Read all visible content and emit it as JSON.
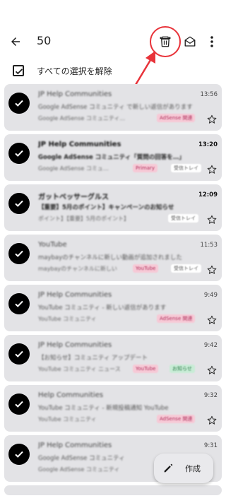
{
  "header": {
    "selected_count": "50",
    "back_icon": "arrow-back-icon",
    "delete_icon": "trash-icon",
    "mark_read_icon": "envelope-open-icon",
    "more_icon": "more-vert-icon"
  },
  "selection": {
    "deselect_all_label": "すべての選択を解除"
  },
  "emails": [
    {
      "sender": "JP Help Communities",
      "time": "13:56",
      "subject": "Google AdSense コミュニティ で新しい返信があります",
      "snippet": "Google AdSense コミュニティ...",
      "chips": [
        {
          "label": "AdSense 関連",
          "bg": "#f6c9d6",
          "fg": "#b0305c"
        }
      ],
      "unread": false
    },
    {
      "sender": "JP Help Communities",
      "time": "13:20",
      "subject": "Google AdSense コミュニティ「質問の回答を…」",
      "snippet": "Google AdSense コミュ…",
      "chips": [
        {
          "label": "Primary",
          "bg": "#f6c9d6",
          "fg": "#b0305c"
        },
        {
          "label": "受信トレイ",
          "bg": "#ffffff",
          "fg": "#555555"
        }
      ],
      "unread": true
    },
    {
      "sender": "ガットベッサーグルス",
      "time": "12:09",
      "subject": "【重要】5月のポイント】キャンペーンのお知らせ",
      "snippet": "ポイント】【重要】5月のポイント】",
      "chips": [
        {
          "label": "受信トレイ",
          "bg": "#ffffff",
          "fg": "#555555"
        }
      ],
      "unread": true
    },
    {
      "sender": "YouTube",
      "time": "11:53",
      "subject": "maybayのチャンネルに新しい動画が追加されました",
      "snippet": "maybayのチャンネルに新しい",
      "chips": [
        {
          "label": "YouTube",
          "bg": "#f6c9d6",
          "fg": "#b0305c"
        },
        {
          "label": "受信トレイ",
          "bg": "#ffffff",
          "fg": "#555555"
        }
      ],
      "unread": false
    },
    {
      "sender": "JP Help Communities",
      "time": "9:49",
      "subject": "YouTube コミュニティ - 新しい返信があります",
      "snippet": "YouTube コミュニティ",
      "chips": [
        {
          "label": "AdSense 関連",
          "bg": "#f6c9d6",
          "fg": "#b0305c"
        }
      ],
      "unread": false
    },
    {
      "sender": "JP Help Communities",
      "time": "9:42",
      "subject": "【お知らせ】コミュニティ アップデート",
      "snippet": "YouTube コミュニティ ニュース",
      "chips": [
        {
          "label": "YouTube",
          "bg": "#f6c9d6",
          "fg": "#b0305c"
        },
        {
          "label": "お知らせ",
          "bg": "#c8ecd6",
          "fg": "#2e7d4a"
        }
      ],
      "unread": false
    },
    {
      "sender": "Help Communities",
      "time": "9:32",
      "subject": "YouTube コミュニティ - 新規投稿通知 YouTube",
      "snippet": "YouTube コミュニティ",
      "chips": [
        {
          "label": "AdSense 関連",
          "bg": "#f6c9d6",
          "fg": "#b0305c"
        }
      ],
      "unread": false
    },
    {
      "sender": "JP Help Communities",
      "time": "9:31",
      "subject": "Google AdSense コミュニティ",
      "snippet": "Google AdSense コミュニティ",
      "chips": [],
      "unread": false
    }
  ],
  "compose": {
    "label": "作成"
  }
}
